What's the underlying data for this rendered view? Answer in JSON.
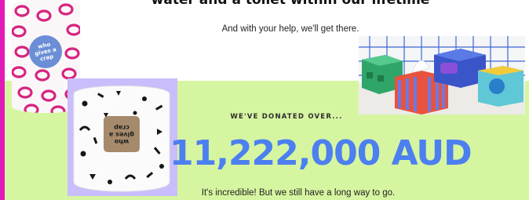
{
  "heading": "water and a toilet within our lifetime",
  "subheading": "And with your help, we'll get there.",
  "donated_label": "WE'VE DONATED OVER...",
  "amount": "11,222,000 AUD",
  "footnote": "It's incredible! But we still have a long way to go.",
  "images": {
    "toilet_roll_pink_label": "who gives a crap",
    "toilet_roll_black_label": "who gives a crap",
    "tissue_boxes_alt": "Colorful tissue boxes"
  },
  "colors": {
    "accent_blue": "#4c7ff0",
    "green_band": "#d6f5a1",
    "magenta_edge": "#e21bb8",
    "lavender_block": "#c9bdfb"
  }
}
